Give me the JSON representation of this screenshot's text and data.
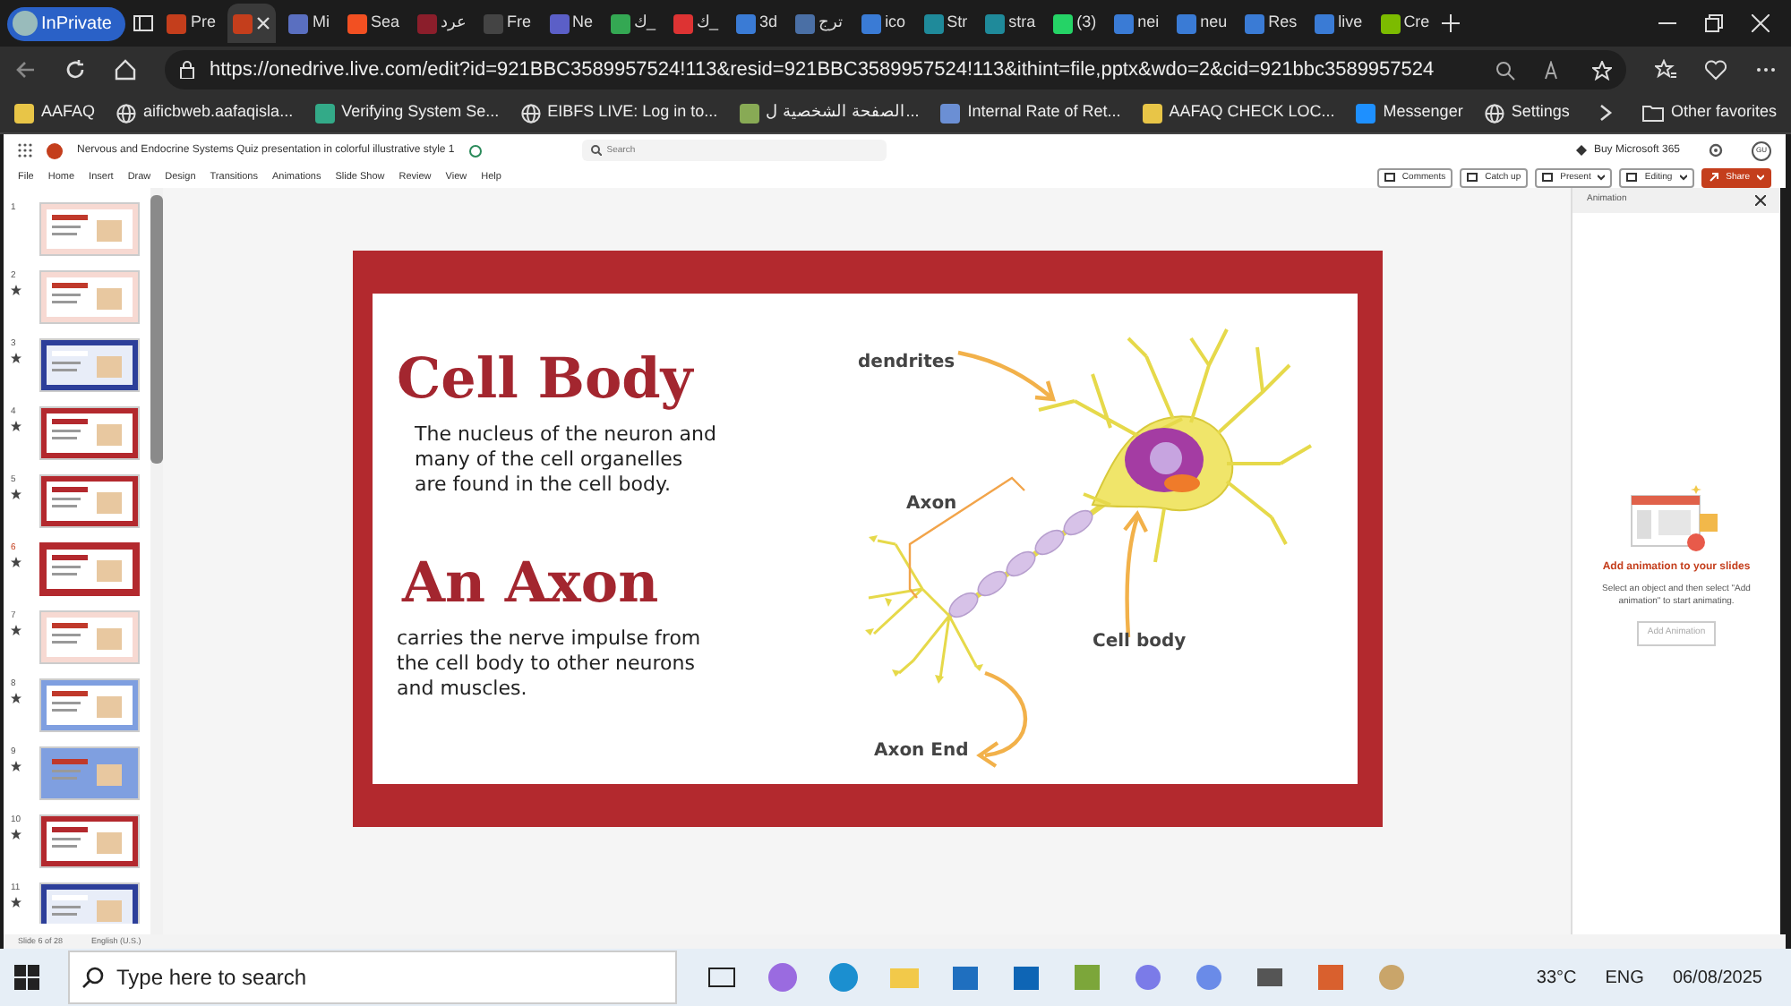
{
  "browser": {
    "profile": "InPrivate",
    "tabs": [
      {
        "label": "Pre",
        "selected": false
      },
      {
        "selected": true
      },
      {
        "label": "Mi",
        "selected": false
      },
      {
        "label": "Sea",
        "selected": false
      },
      {
        "label": "عرد",
        "selected": false
      },
      {
        "label": "Fre",
        "selected": false
      },
      {
        "label": "Ne",
        "selected": false
      },
      {
        "label": "ك_",
        "selected": false
      },
      {
        "label": "ك_",
        "selected": false
      },
      {
        "label": "3d",
        "selected": false
      },
      {
        "label": "ترج",
        "selected": false
      },
      {
        "label": "ico",
        "selected": false
      },
      {
        "label": "Str",
        "selected": false
      },
      {
        "label": "stra",
        "selected": false
      },
      {
        "label": "(3)",
        "selected": false
      },
      {
        "label": "nei",
        "selected": false
      },
      {
        "label": "neu",
        "selected": false
      },
      {
        "label": "Res",
        "selected": false
      },
      {
        "label": "live",
        "selected": false
      },
      {
        "label": "Cre",
        "selected": false
      }
    ],
    "address": "https://onedrive.live.com/edit?id=921BBC3589957524!113&resid=921BBC3589957524!113&ithint=file,pptx&wdo=2&cid=921bbc3589957524",
    "favorites": [
      "AAFAQ",
      "aificbweb.aafaqisla...",
      "Verifying System Se...",
      "EIBFS LIVE: Log in to...",
      "الصفحة الشخصية ل...",
      "Internal Rate of Ret...",
      "AAFAQ CHECK LOC...",
      "Messenger",
      "Settings"
    ],
    "other_favorites": "Other favorites"
  },
  "app": {
    "title": "Nervous and Endocrine Systems Quiz presentation in colorful illustrative style 1",
    "search_placeholder": "Search",
    "buy": "Buy Microsoft 365",
    "avatar": "GU",
    "menu": [
      "File",
      "Home",
      "Insert",
      "Draw",
      "Design",
      "Transitions",
      "Animations",
      "Slide Show",
      "Review",
      "View",
      "Help"
    ],
    "actions": [
      {
        "label": "Comments",
        "kind": "plain"
      },
      {
        "label": "Catch up",
        "kind": "plain"
      },
      {
        "label": "Present",
        "kind": "menu"
      },
      {
        "label": "Editing",
        "kind": "menu"
      },
      {
        "label": "Share",
        "kind": "primary"
      }
    ]
  },
  "thumbnails": [
    {
      "number": "1",
      "selected": false,
      "animated": false,
      "kind": "pink"
    },
    {
      "number": "2",
      "selected": false,
      "animated": true,
      "kind": "pink"
    },
    {
      "number": "3",
      "selected": false,
      "animated": true,
      "kind": "navy"
    },
    {
      "number": "4",
      "selected": false,
      "animated": true,
      "kind": "framed"
    },
    {
      "number": "5",
      "selected": false,
      "animated": true,
      "kind": "framed"
    },
    {
      "number": "6",
      "selected": true,
      "animated": true,
      "kind": "framed"
    },
    {
      "number": "7",
      "selected": false,
      "animated": true,
      "kind": "pink"
    },
    {
      "number": "8",
      "selected": false,
      "animated": true,
      "kind": "blue"
    },
    {
      "number": "9",
      "selected": false,
      "animated": true,
      "kind": "sky"
    },
    {
      "number": "10",
      "selected": false,
      "animated": true,
      "kind": "framed"
    },
    {
      "number": "11",
      "selected": false,
      "animated": true,
      "kind": "navy"
    }
  ],
  "status_bar": {
    "slide": "Slide 6 of 28",
    "language": "English (U.S.)"
  },
  "slide": {
    "heading_1": "Cell Body",
    "text_1": "The nucleus of the neuron and many of the cell organelles are found in the cell body.",
    "heading_2": "An Axon",
    "text_2": "carries the nerve impulse from the cell body to other neurons and muscles.",
    "labels": [
      "dendrites",
      "Axon",
      "Cell body",
      "Axon End"
    ]
  },
  "animation_pane": {
    "title": "Animation",
    "heading": "Add animation to your slides",
    "hint": "Select an object and then select \"Add animation\" to start animating.",
    "button": {
      "label": "Add Animation",
      "disabled": true
    }
  },
  "taskbar": {
    "search_placeholder": "Type here to search",
    "weather": "33°C",
    "language": "ENG",
    "date": "06/08/2025"
  }
}
